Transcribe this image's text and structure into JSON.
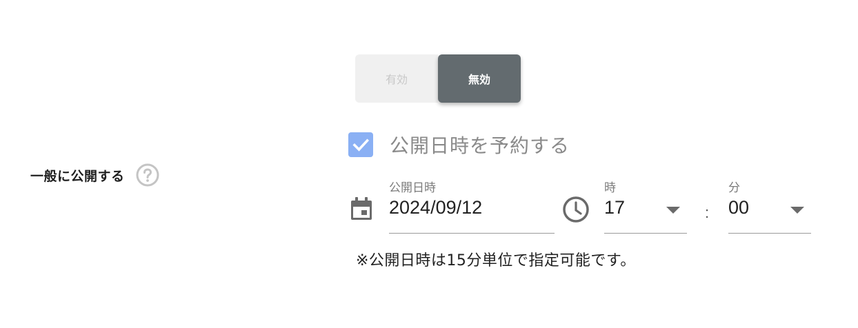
{
  "section": {
    "label": "一般に公開する"
  },
  "toggle": {
    "enabled_label": "有効",
    "disabled_label": "無効",
    "selected": "無効"
  },
  "schedule": {
    "checkbox_label": "公開日時を予約する",
    "checked": true,
    "date_label": "公開日時",
    "date_value": "2024/09/12",
    "hour_label": "時",
    "hour_value": "17",
    "separator": ":",
    "minute_label": "分",
    "minute_value": "00",
    "note": "※公開日時は15分単位で指定可能です。"
  },
  "colors": {
    "toggle_active_bg": "#636b6f",
    "toggle_inactive_bg": "#f0f0f0",
    "checkbox_bg": "#8ab0f4",
    "icon_gray": "#6a6a6a"
  },
  "icons": {
    "help": "question-circle-icon",
    "calendar": "calendar-icon",
    "clock": "clock-icon",
    "check": "check-icon",
    "dropdown": "chevron-down-icon"
  }
}
